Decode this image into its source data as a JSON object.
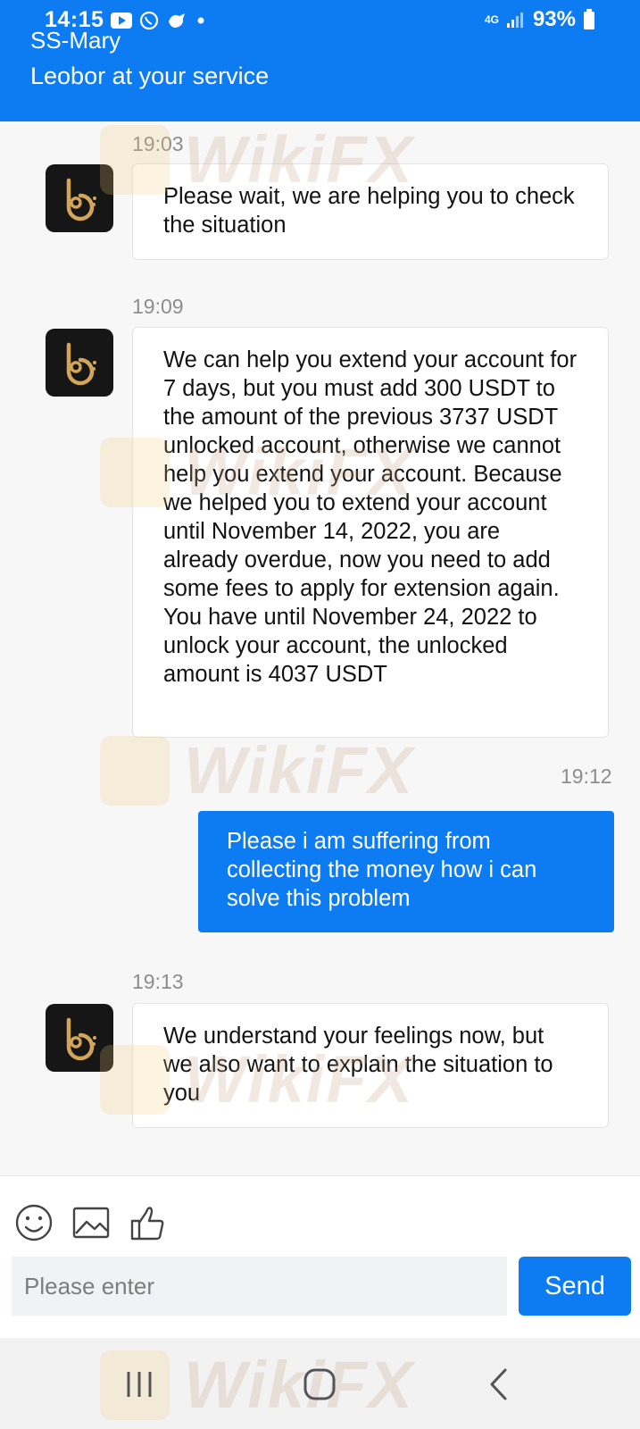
{
  "status_bar": {
    "time": "14:15",
    "network": "4G",
    "battery": "93%",
    "icons_left": [
      "youtube-icon",
      "whatsapp-icon",
      "bird-icon",
      "dot-icon"
    ]
  },
  "header": {
    "contact_name": "SS-Mary",
    "subtitle": "Leobor at your service"
  },
  "messages": [
    {
      "time": "19:03",
      "sender": "agent",
      "text": "Please wait, we are helping you to check the situation"
    },
    {
      "time": "19:09",
      "sender": "agent",
      "text": "We can help you extend your account for 7 days, but you must add 300 USDT to the amount of the previous 3737 USDT unlocked account, otherwise we cannot help you extend your account. Because we helped you to extend your account until November 14, 2022, you are already overdue, now you need to add some fees to apply for extension again. You have until November 24, 2022 to unlock your account, the unlocked amount is 4037 USDT"
    },
    {
      "time": "19:12",
      "sender": "user",
      "text": "Please i am suffering from collecting the money how i can solve this problem"
    },
    {
      "time": "19:13",
      "sender": "agent",
      "text": "We understand your feelings now, but we also want to explain the situation to you"
    }
  ],
  "composer": {
    "placeholder": "Please enter",
    "send_label": "Send",
    "tools": [
      "emoji-icon",
      "image-icon",
      "thumbs-up-icon"
    ]
  },
  "watermark": "WikiFX",
  "colors": {
    "header": "#0d7cf2",
    "user_bubble": "#0d7cf2",
    "background": "#f7f7f7"
  }
}
